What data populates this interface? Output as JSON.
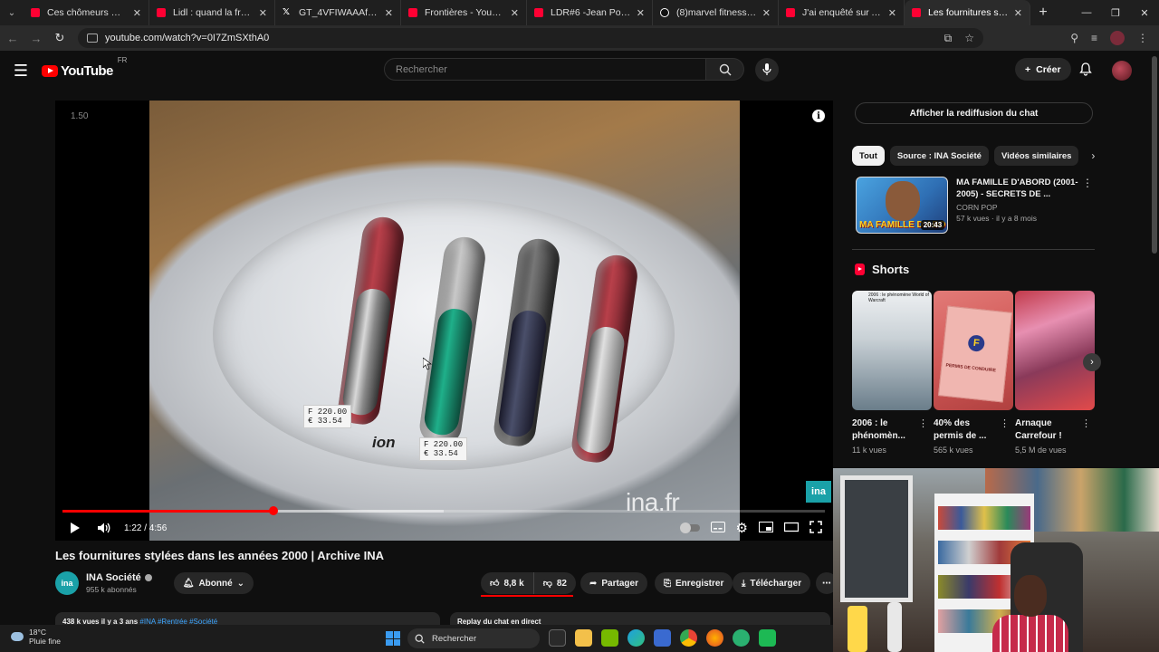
{
  "browser": {
    "tabs": [
      {
        "label": "Ces chômeurs multiplient",
        "icon": "youtube-icon",
        "active": false
      },
      {
        "label": "Lidl : quand la fréquence",
        "icon": "youtube-icon",
        "active": false
      },
      {
        "label": "GT_4VFIWAAAfQ9C.jpg:la",
        "icon": "x-icon",
        "active": false
      },
      {
        "label": "Frontières - YouTube",
        "icon": "youtube-icon",
        "active": false
      },
      {
        "label": "LDR#6 -Jean Pormanove",
        "icon": "youtube-icon",
        "active": false
      },
      {
        "label": "(8)marvel fitness (@marv",
        "icon": "tiktok-icon",
        "active": false
      },
      {
        "label": "J'ai enquêté sur Action, l",
        "icon": "youtube-icon",
        "active": false
      },
      {
        "label": "Les fournitures stylées da",
        "icon": "youtube-icon",
        "active": true
      }
    ],
    "url": "youtube.com/watch?v=0I7ZmSXthA0"
  },
  "header": {
    "logo_text": "YouTube",
    "region": "FR",
    "search_placeholder": "Rechercher",
    "create_label": "Créer"
  },
  "player": {
    "corner_badge": "1.50",
    "watermark": "ina.fr",
    "channel_badge": "ina",
    "current_time": "1:22",
    "duration": "4:56",
    "time_display": "1:22 / 4:56",
    "progress_fraction": 0.277,
    "buffered_fraction": 0.5,
    "product_label": "ion",
    "price_tags": [
      {
        "line1": "F  220.00",
        "line2": "€  33.54"
      },
      {
        "line1": "F  220.00",
        "line2": "€  33.54"
      }
    ]
  },
  "video": {
    "title": "Les fournitures stylées dans les années 2000 | Archive INA",
    "channel": {
      "name": "INA Société",
      "subscribers": "955 k abonnés",
      "avatar_text": "ina"
    },
    "subscribed_label": "Abonné",
    "likes": "8,8 k",
    "dislikes": "82",
    "share_label": "Partager",
    "save_label": "Enregistrer",
    "download_label": "Télécharger",
    "description_stats": "438 k vues  il y a 3 ans",
    "description_tags": "#INA #Rentrée #Société",
    "chat_replay_box": "Replay du chat en direct"
  },
  "sidebar": {
    "chat_replay_button": "Afficher la rediffusion du chat",
    "chips": [
      {
        "label": "Tout",
        "active": true
      },
      {
        "label": "Source : INA Société",
        "active": false
      },
      {
        "label": "Vidéos similaires",
        "active": false
      }
    ],
    "recommendation": {
      "title": "MA FAMILLE D'ABORD (2001-2005) - SECRETS DE ...",
      "channel": "CORN POP",
      "stats": "57 k vues · il y a 8 mois",
      "duration": "20:43",
      "thumb_text": "MA FAMILLE D'ABO"
    },
    "shorts_heading": "Shorts",
    "shorts": [
      {
        "title": "2006 : le phénomèn...",
        "views": "11 k vues",
        "thumb_text": "2006 : le phénomène World of Warcraft"
      },
      {
        "title": "40% des permis de ...",
        "views": "565 k vues",
        "thumb_text": "PERMIS DE CONDUIRE"
      },
      {
        "title": "Arnaque Carrefour !",
        "views": "5,5 M de vues",
        "thumb_text": ""
      }
    ]
  },
  "taskbar": {
    "temperature": "18°C",
    "weather": "Pluie fine",
    "search_label": "Rechercher"
  },
  "colors": {
    "accent": "#ff0000",
    "background": "#0f0f0f",
    "chip_bg": "#272727",
    "ina_teal": "#1aa1a8"
  }
}
